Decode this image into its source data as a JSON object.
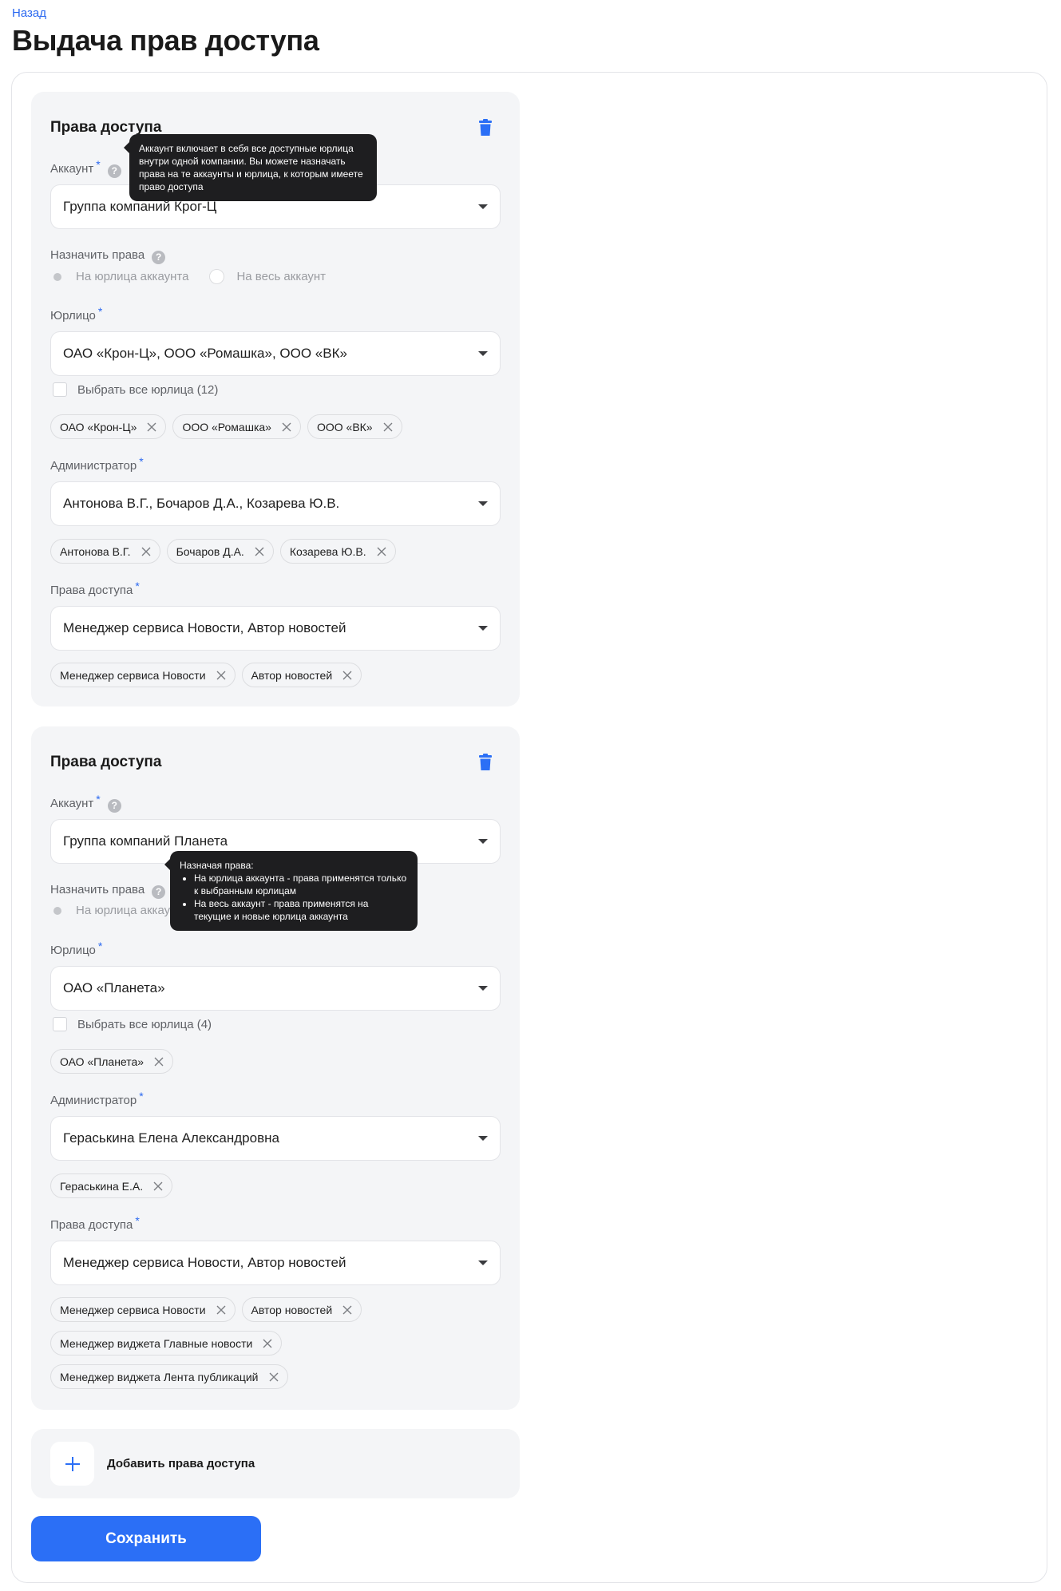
{
  "nav": {
    "back_label": "Назад"
  },
  "page": {
    "title": "Выдача прав доступа"
  },
  "sections": [
    {
      "title": "Права доступа",
      "account": {
        "label": "Аккаунт",
        "value": "Группа компаний Крог-Ц"
      },
      "assign": {
        "label": "Назначить права",
        "option1": "На юрлица аккаунта",
        "option2": "На весь аккаунт"
      },
      "legal": {
        "label": "Юрлицо",
        "value": "ОАО «Крон-Ц», ООО «Ромашка», ООО «ВК»",
        "select_all": "Выбрать все юрлица (12)",
        "chips": [
          "ОАО «Крон-Ц»",
          "ООО «Ромашка»",
          "ООО «ВК»"
        ]
      },
      "admin": {
        "label": "Администратор",
        "value": "Антонова В.Г., Бочаров Д.А., Козарева Ю.В.",
        "chips": [
          "Антонова В.Г.",
          "Бочаров Д.А.",
          "Козарева Ю.В."
        ]
      },
      "rights": {
        "label": "Права доступа",
        "value": "Менеджер сервиса Новости, Автор новостей",
        "chips": [
          "Менеджер сервиса Новости",
          "Автор новостей"
        ]
      },
      "tooltip": "Аккаунт включает в себя все доступные юрлица внутри одной компании. Вы можете назначать права на те аккаунты и юрлица, к которым имеете право доступа"
    },
    {
      "title": "Права доступа",
      "account": {
        "label": "Аккаунт",
        "value": "Группа компаний Планета"
      },
      "assign": {
        "label": "Назначить права",
        "option1": "На юрлица аккаунта"
      },
      "legal": {
        "label": "Юрлицо",
        "value": "ОАО «Планета»",
        "select_all": "Выбрать все юрлица (4)",
        "chips": [
          "ОАО «Планета»"
        ]
      },
      "admin": {
        "label": "Администратор",
        "value": "Гераськина Елена Александровна",
        "chips": [
          "Гераськина Е.А."
        ]
      },
      "rights": {
        "label": "Права доступа",
        "value": "Менеджер сервиса Новости, Автор новостей",
        "chips": [
          "Менеджер сервиса Новости",
          "Автор новостей",
          "Менеджер виджета Главные новости",
          "Менеджер виджета Лента публикаций"
        ]
      },
      "tooltip": {
        "title": "Назначая права:",
        "items": [
          "На юрлица аккаунта - права применятся только к выбранным юрлицам",
          "На весь аккаунт - права применятся на текущие и новые юрлица аккаунта"
        ]
      }
    }
  ],
  "add": {
    "label": "Добавить права доступа"
  },
  "save": {
    "label": "Сохранить"
  },
  "colors": {
    "accent": "#2b6ff6",
    "link": "#2a68f0",
    "tooltip_bg": "#1e1e20",
    "section_bg": "#f4f5f7"
  },
  "icons": {
    "delete": "trash-icon",
    "help": "question-icon",
    "dropdown": "caret-down-icon",
    "remove": "close-icon",
    "add": "plus-icon"
  }
}
